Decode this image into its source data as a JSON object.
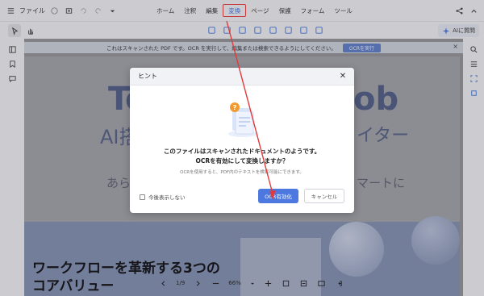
{
  "menubar": {
    "file_label": "ファイル",
    "items": [
      "ホーム",
      "注釈",
      "編集",
      "変換",
      "ページ",
      "保護",
      "フォーム",
      "ツール"
    ],
    "highlighted_index": 3
  },
  "toolbar": {
    "ai_label": "AIに質問"
  },
  "banner": {
    "text": "これはスキャンされた PDF です。OCR を実行して、編集または検索できるようにしてください。",
    "button": "OCRを実行"
  },
  "document": {
    "title_left": "To",
    "title_right": "ob",
    "subtitle_left": "AI搭",
    "subtitle_right": "イター",
    "line3_left": "あら",
    "line3_right": "マートに",
    "heading": "ワークフローを革新する3つのコアバリュー"
  },
  "pager": {
    "page": "1/9",
    "zoom": "66%"
  },
  "dialog": {
    "title": "ヒント",
    "line1": "このファイルはスキャンされたドキュメントのようです。",
    "line2": "OCRを有効にして変換しますか？",
    "note": "OCRを使用すると、PDF内のテキストを検索可能にできます。",
    "checkbox_label": "今後表示しない",
    "primary_button": "OCR有効化",
    "secondary_button": "キャンセル"
  },
  "colors": {
    "accent": "#4c78e0",
    "annotation": "#e23a3a"
  }
}
